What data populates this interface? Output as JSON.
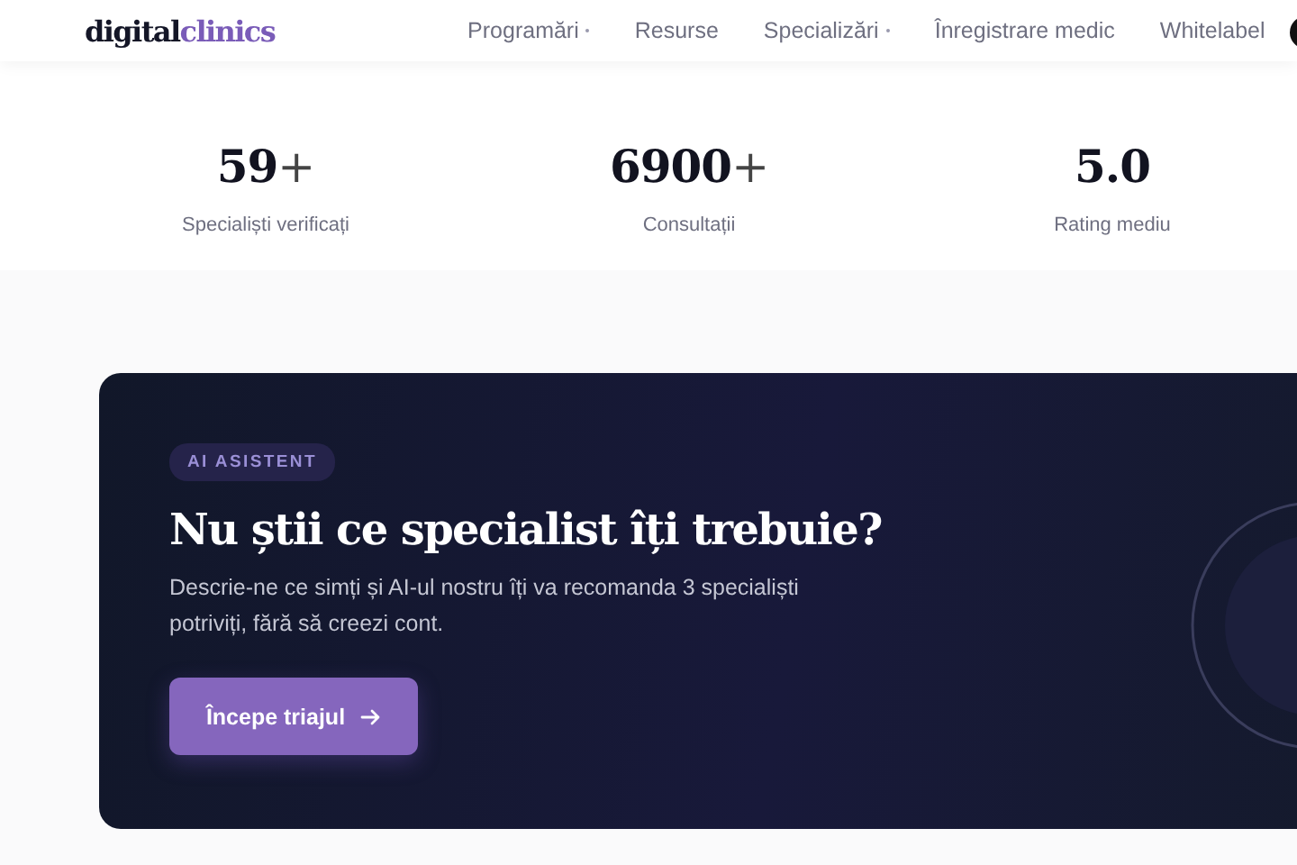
{
  "header": {
    "logo": {
      "first": "digital",
      "second": "clinics"
    },
    "nav": [
      {
        "label": "Programări",
        "dropdown": true
      },
      {
        "label": "Resurse",
        "dropdown": false
      },
      {
        "label": "Specializări",
        "dropdown": true
      },
      {
        "label": "Înregistrare medic",
        "dropdown": false
      },
      {
        "label": "Whitelabel",
        "dropdown": false
      }
    ]
  },
  "stats": [
    {
      "value": "59",
      "suffix": "+",
      "label": "Specialiști verificați"
    },
    {
      "value": "6900",
      "suffix": "+",
      "label": "Consultații"
    },
    {
      "value": "5.0",
      "label": "Rating mediu"
    }
  ],
  "promo": {
    "badge": "AI ASISTENT",
    "title": "Nu știi ce specialist îți trebuie?",
    "text": "Descrie-ne ce simți și AI-ul nostru îți va recomanda 3 specialiști potriviți, fără să creezi cont.",
    "button": "Începe triajul"
  }
}
